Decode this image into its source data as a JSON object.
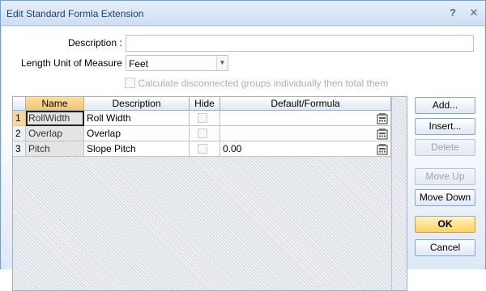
{
  "window": {
    "title": "Edit Standard Formla Extension",
    "help_glyph": "?",
    "close_glyph": "✕"
  },
  "form": {
    "description_label": "Description :",
    "description_value": "",
    "unit_label": "Length Unit of Measure :",
    "unit_value": "Feet",
    "calc_checkbox_label": "Calculate disconnected groups individually then total them",
    "calc_checkbox_checked": false,
    "calc_checkbox_enabled": false
  },
  "grid": {
    "columns": [
      "Name",
      "Description",
      "Hide",
      "Default/Formula"
    ],
    "rows": [
      {
        "num": "1",
        "name": "RollWidth",
        "description": "Roll Width",
        "hide": false,
        "formula": ""
      },
      {
        "num": "2",
        "name": "Overlap",
        "description": "Overlap",
        "hide": false,
        "formula": ""
      },
      {
        "num": "3",
        "name": "Pitch",
        "description": "Slope Pitch",
        "hide": false,
        "formula": "0.00"
      }
    ]
  },
  "buttons": {
    "add": "Add...",
    "insert": "Insert...",
    "delete": "Delete",
    "move_up": "Move Up",
    "move_down": "Move Down",
    "ok": "OK",
    "cancel": "Cancel"
  },
  "icons": {
    "formula_button": "formula-editor-icon",
    "help": "help-icon",
    "close": "close-icon",
    "dropdown": "chevron-down-icon"
  },
  "colors": {
    "accent": "#f4c46a",
    "title_text": "#1e3f73",
    "border": "#7a9cc9"
  }
}
